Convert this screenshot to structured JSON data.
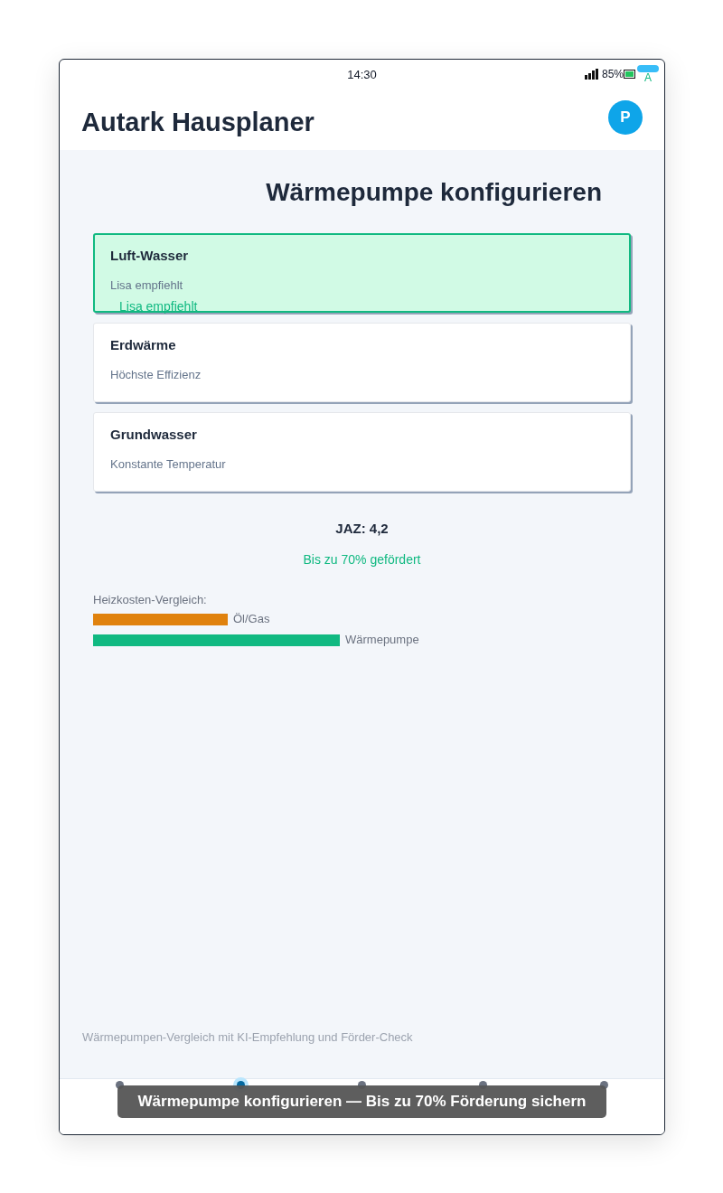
{
  "status_bar": {
    "time": "14:30",
    "battery": "85%",
    "badge_letter": "A"
  },
  "app_bar": {
    "title": "Autark Hausplaner",
    "avatar": "P"
  },
  "page_title": "Wärmepumpe konfigurieren",
  "options": [
    {
      "title": "Luft-Wasser",
      "subtitle": "Lisa empfiehlt",
      "selected": true,
      "recommendation": "Lisa empfiehlt"
    },
    {
      "title": "Erdwärme",
      "subtitle": "Höchste Effizienz",
      "selected": false
    },
    {
      "title": "Grundwasser",
      "subtitle": "Konstante Temperatur",
      "selected": false
    }
  ],
  "jaz": "JAZ: 4,2",
  "funding": "Bis zu 70% gefördert",
  "comparison": {
    "label": "Heizkosten-Vergleich:",
    "bars": [
      {
        "name": "Öl/Gas",
        "color": "#e0820e"
      },
      {
        "name": "Wärmepumpe",
        "color": "#10b981"
      }
    ]
  },
  "footer_note": "Wärmepumpen-Vergleich mit KI-Empfehlung und Förder-Check",
  "nav": [
    {
      "selected": false
    },
    {
      "selected": true
    },
    {
      "selected": false
    },
    {
      "selected": false
    },
    {
      "selected": false
    }
  ],
  "toast": "Wärmepumpe konfigurieren — Bis zu 70% Förderung sichern"
}
